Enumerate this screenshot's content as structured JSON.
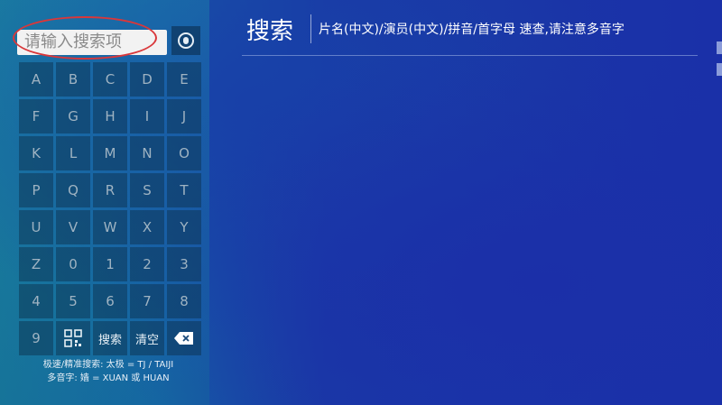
{
  "search": {
    "placeholder": "请输入搜索项"
  },
  "header": {
    "title": "搜索",
    "subtitle": "片名(中文)/演员(中文)/拼音/首字母 速查,请注意多音字"
  },
  "keyboard": {
    "rows": [
      [
        "A",
        "B",
        "C",
        "D",
        "E"
      ],
      [
        "F",
        "G",
        "H",
        "I",
        "J"
      ],
      [
        "K",
        "L",
        "M",
        "N",
        "O"
      ],
      [
        "P",
        "Q",
        "R",
        "S",
        "T"
      ],
      [
        "U",
        "V",
        "W",
        "X",
        "Y"
      ],
      [
        "Z",
        "0",
        "1",
        "2",
        "3"
      ],
      [
        "4",
        "5",
        "6",
        "7",
        "8"
      ]
    ],
    "last_row": {
      "nine": "9",
      "search_label": "搜索",
      "clear_label": "清空"
    }
  },
  "hints": {
    "line1": "极速/精准搜索: 太极 = TJ / TAIJI",
    "line2": "多音字: 嫱 = XUAN 或 HUAN"
  },
  "icons": {
    "voice": "voice-search-icon",
    "qr": "qr-code-icon",
    "backspace": "backspace-icon"
  }
}
